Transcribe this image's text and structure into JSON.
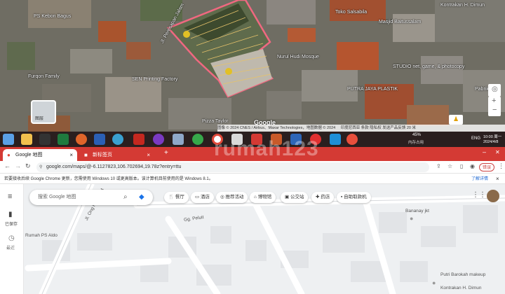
{
  "satellite": {
    "labels": {
      "ps_kebon": "PS Kebon Bagus",
      "toko": "Toko Salsabila",
      "kontrakan": "Kontrakan H. Dimun",
      "masjid": "Masjid Baitussalam",
      "mosque": "Nurul Hudi Mosque",
      "studio": "STUDIO net, game, & photocopy",
      "fuqon": "Furqon Family",
      "sen": "SEN Printing Factory",
      "plastik": "PUTRA JAYA PLASTIK",
      "pabrik": "Pabrik",
      "pizza": "Pizza Taylor",
      "street": "Jl. Peresapan Jalam",
      "layer": "图层",
      "google": "Google",
      "attribution": "图像 © 2024 CNES / Airbus、Maxar Technologies，地图数据 © 2024",
      "attribution_links": "印度尼西亚  条款  隐私权  发送产品反馈  20 米"
    },
    "watermark": "rumah123"
  },
  "taskbar": {
    "battery": "45%",
    "battery_sub": "内存占用",
    "lang": "ENG",
    "time": "10:00 周一",
    "date": "2024/4/8"
  },
  "browser": {
    "tabs": [
      {
        "label": "Google 地图"
      },
      {
        "label": "新标签页"
      }
    ],
    "new_tab": "+",
    "url": "google.com/maps/@-6.1127823,106.702694,19.78z?entry=ttu",
    "error_btn": "错误",
    "infobar": "若要接收后续 Google Chrome 更新，您需使用 Windows 10 或更高版本。该计算机目前使用的是 Windows 8.1。",
    "infobar_link": "了解详情"
  },
  "maps": {
    "search_placeholder": "搜索 Google 地图",
    "rail": {
      "saved": "已保存",
      "recent": "最近"
    },
    "chips": [
      "餐厅",
      "酒店",
      "推荐活动",
      "博物馆",
      "公交站",
      "药店",
      "自助取款机"
    ],
    "labels": {
      "gg_peluit": "Gg. Peluit",
      "jl_ong": "Jl. Ong Kawaca 4",
      "bananay": "Bananay jkt",
      "rumah": "Rumah PS Aldo",
      "barokah": "Putri Barokah makeup",
      "kontrakan": "Kontrakan H. Dimun"
    }
  }
}
